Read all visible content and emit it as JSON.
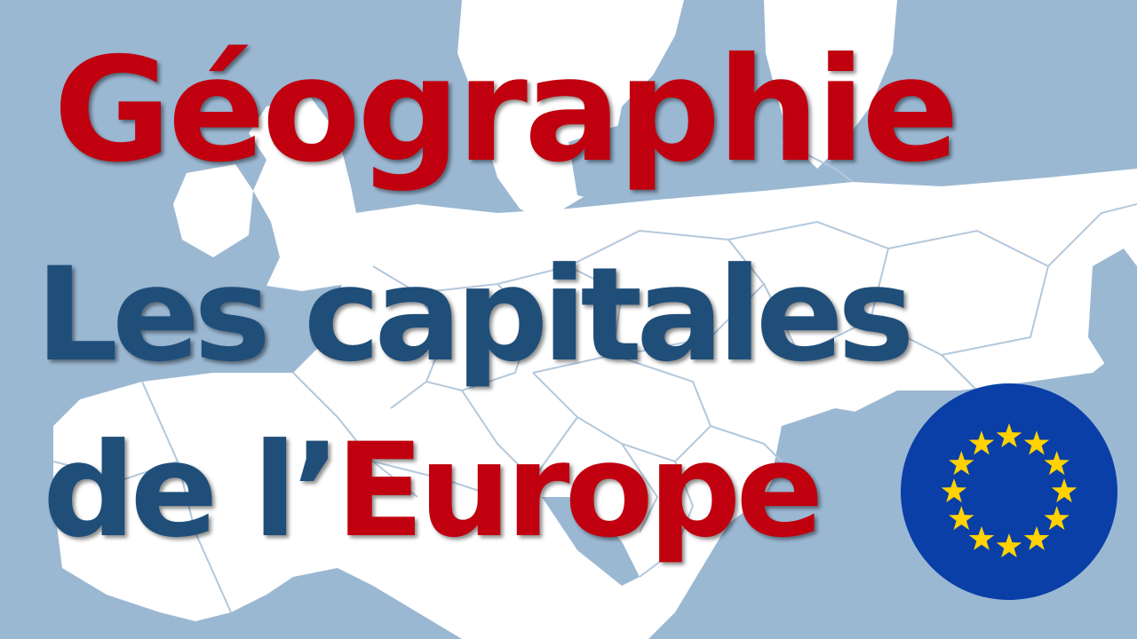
{
  "title": {
    "line1": "Géographie",
    "line2": "Les capitales",
    "line3_part1": "de l’",
    "line3_part2": "Europe"
  },
  "icons": {
    "background": "europe-map-icon",
    "flag": "eu-flag-icon"
  },
  "colors": {
    "red": "#c0000e",
    "blue": "#1f4e79",
    "sea": "#9bb8d3",
    "land": "#ffffff",
    "border": "#b3c8db",
    "flag_blue": "#0a3fa8",
    "star": "#ffd200"
  }
}
